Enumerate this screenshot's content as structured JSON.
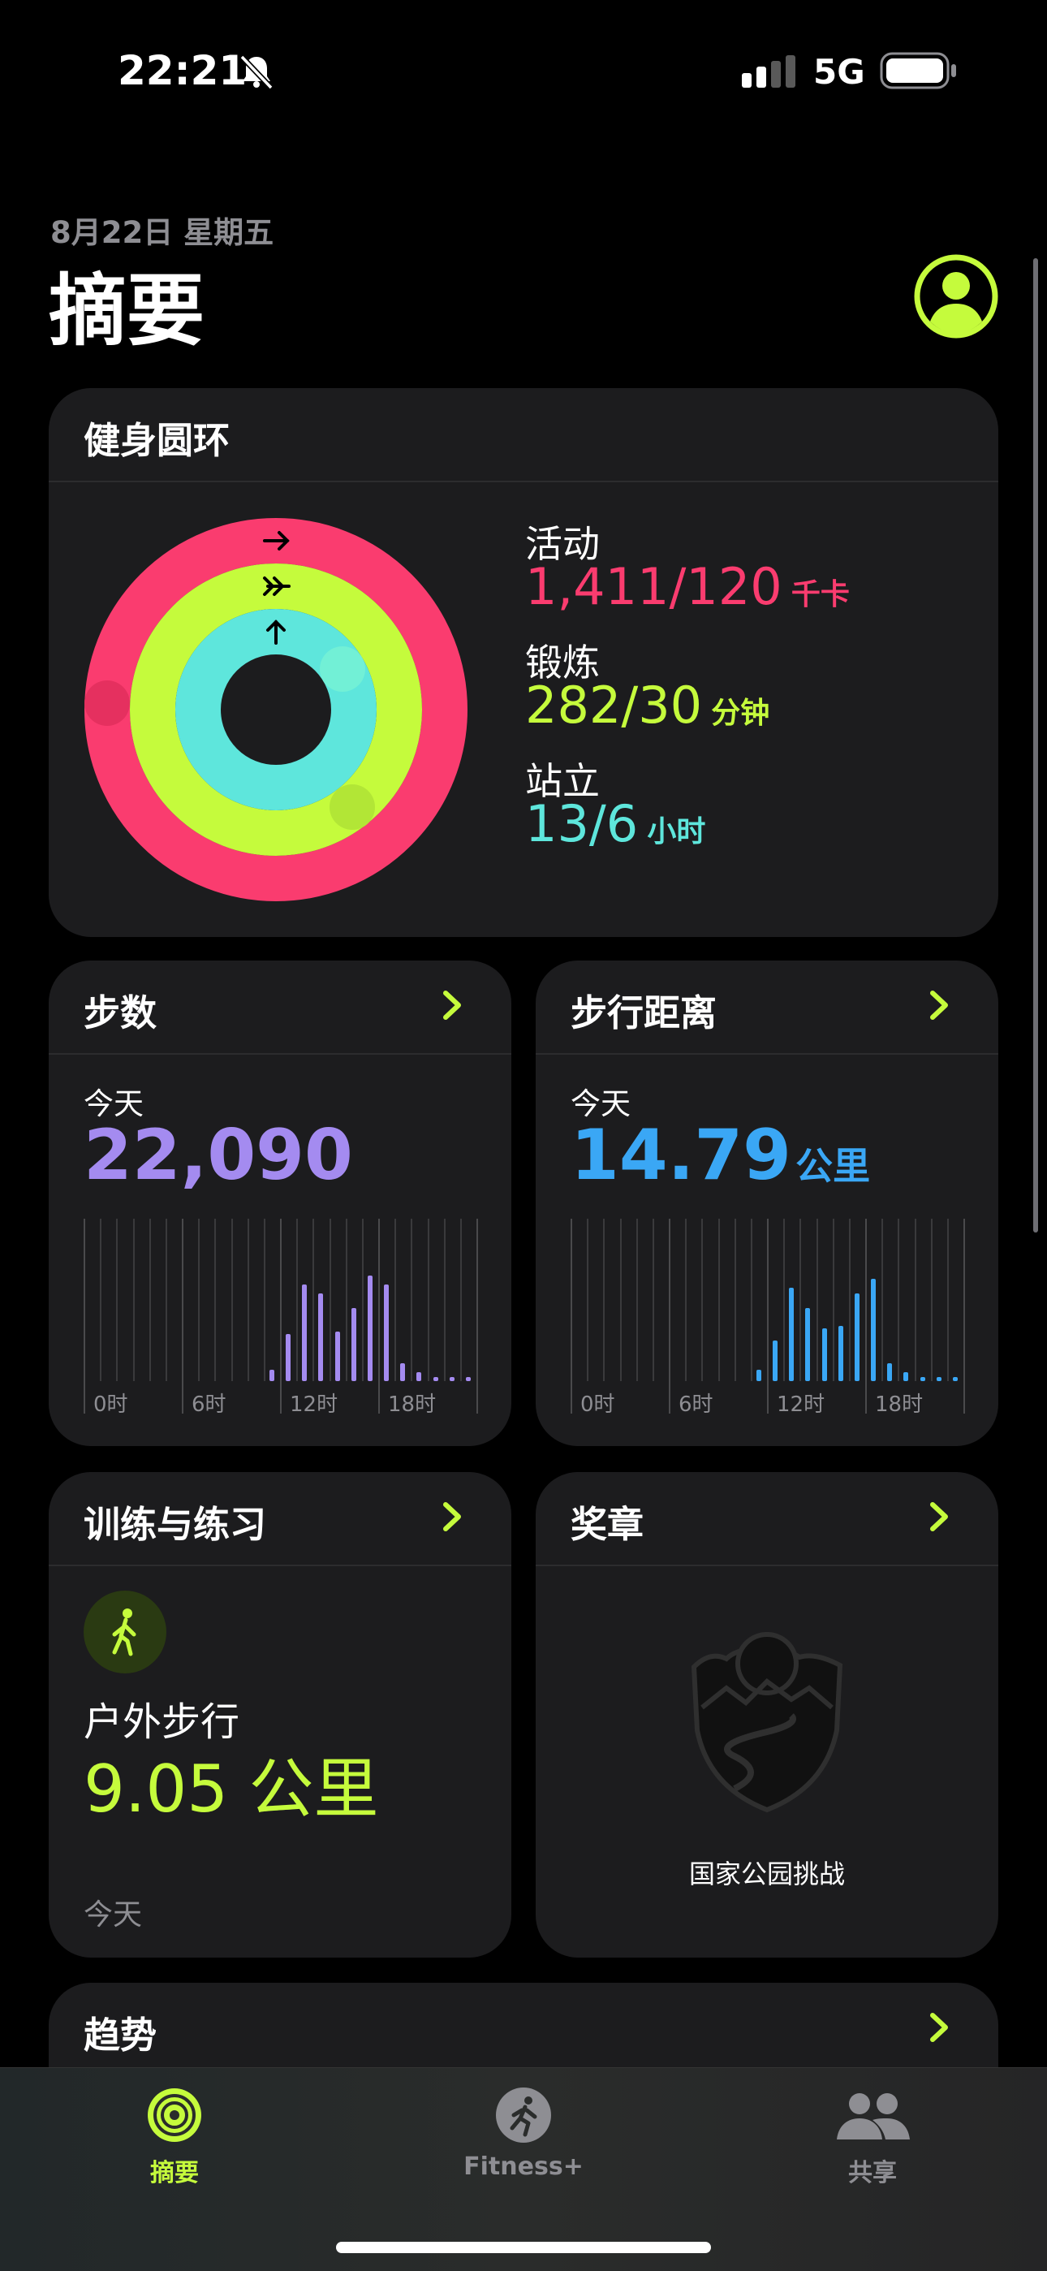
{
  "status_bar": {
    "time": "22:21",
    "network": "5G"
  },
  "header": {
    "date": "8月22日 星期五",
    "title": "摘要"
  },
  "rings_card": {
    "title": "健身圆环",
    "move": {
      "label": "活动",
      "value": "1,411/120",
      "unit": "千卡",
      "color": "#fa3c6f"
    },
    "exercise": {
      "label": "锻炼",
      "value": "282/30",
      "unit": "分钟",
      "color": "#c5fb3c"
    },
    "stand": {
      "label": "站立",
      "value": "13/6",
      "unit": "小时",
      "color": "#5ee6dc"
    }
  },
  "steps_card": {
    "title": "步数",
    "day_label": "今天",
    "value": "22,090",
    "color": "#a48bf0",
    "axis_labels": [
      "0时",
      "6时",
      "12时",
      "18时"
    ],
    "hourly": [
      0,
      0,
      0,
      0,
      0,
      0,
      0,
      0,
      0,
      0,
      0,
      0.08,
      0.32,
      0.66,
      0.6,
      0.34,
      0.5,
      0.72,
      0.66,
      0.12,
      0.06,
      0.03,
      0.03,
      0.03
    ]
  },
  "distance_card": {
    "title": "步行距离",
    "day_label": "今天",
    "value": "14.79",
    "unit": "公里",
    "color": "#3aa7f5",
    "axis_labels": [
      "0时",
      "6时",
      "12时",
      "18时"
    ],
    "hourly": [
      0,
      0,
      0,
      0,
      0,
      0,
      0,
      0,
      0,
      0,
      0,
      0.08,
      0.28,
      0.64,
      0.5,
      0.36,
      0.38,
      0.6,
      0.7,
      0.12,
      0.06,
      0.03,
      0.03,
      0.03
    ]
  },
  "workouts_card": {
    "title": "训练与练习",
    "workout_name": "户外步行",
    "distance": "9.05 公里",
    "date": "今天",
    "color": "#c5fb3c"
  },
  "awards_card": {
    "title": "奖章",
    "award_name": "国家公园挑战"
  },
  "trends_card": {
    "title": "趋势"
  },
  "tab_bar": {
    "tabs": [
      {
        "label": "摘要",
        "icon": "rings-icon",
        "active": true
      },
      {
        "label": "Fitness+",
        "icon": "running-figure-icon",
        "active": false
      },
      {
        "label": "共享",
        "icon": "people-icon",
        "active": false
      }
    ],
    "active_color": "#c5fb3c",
    "inactive_color": "#8e8e93"
  }
}
